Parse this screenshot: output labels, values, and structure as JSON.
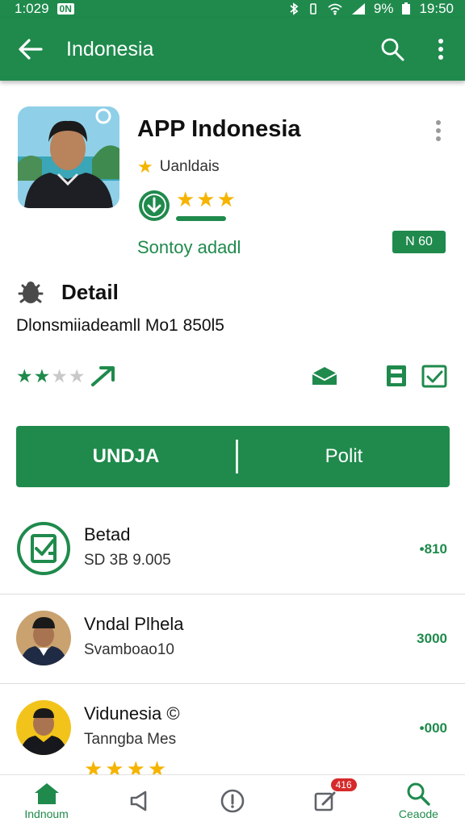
{
  "colors": {
    "primary": "#1f8a4c",
    "star": "#f5b400",
    "badge": "#d62a2a"
  },
  "status_bar": {
    "left_time": "1:029",
    "left_badge": "0N",
    "battery": "9%",
    "time": "19:50"
  },
  "app_bar": {
    "title": "Indonesia",
    "icons": [
      "back-arrow-icon",
      "search-icon",
      "more-vert-icon"
    ]
  },
  "app": {
    "title": "APP Indonesia",
    "developer": "Uanldais",
    "rating_stars": 3,
    "subtitle": "Sontoy adadl",
    "tag": "N 60"
  },
  "detail": {
    "heading": "Detail",
    "text": "Dlonsmiiadeamll Mo1 850l5",
    "rating": {
      "filled": 2,
      "total": 4
    }
  },
  "buttons": {
    "primary": "UNDJA",
    "secondary": "Polit"
  },
  "list": [
    {
      "title": "Betad",
      "subtitle": "SD 3B 9.005",
      "value": "•810",
      "avatar": "check-document-icon"
    },
    {
      "title": "Vndal Plhela",
      "subtitle": "Svamboao10",
      "value": "3000",
      "avatar": "person-photo"
    },
    {
      "title": "Vidunesia ©",
      "subtitle": "Tanngba Mes",
      "value": "•000",
      "avatar": "person-photo",
      "stars": 4
    }
  ],
  "bottom_nav": [
    {
      "label": "Indnoum",
      "icon": "home-icon"
    },
    {
      "label": "",
      "icon": "speaker-icon"
    },
    {
      "label": "",
      "icon": "info-icon"
    },
    {
      "label": "",
      "icon": "edit-icon",
      "badge": "416"
    },
    {
      "label": "Ceaode",
      "icon": "search-icon"
    }
  ]
}
